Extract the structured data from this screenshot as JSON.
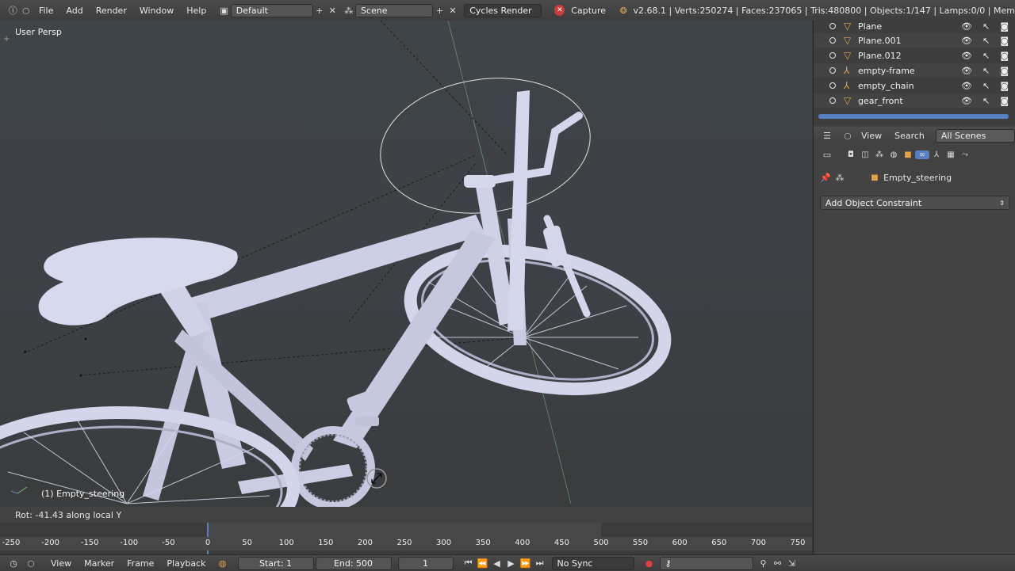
{
  "topbar": {
    "menus": [
      "File",
      "Add",
      "Render",
      "Window",
      "Help"
    ],
    "layout": "Default",
    "scene": "Scene",
    "engine": "Cycles Render",
    "capture": "Capture",
    "stats": "v2.68.1 | Verts:250274 | Faces:237065 | Tris:480800 | Objects:1/147 | Lamps:0/0 | Mem"
  },
  "viewport": {
    "view_name": "User Persp",
    "object_label": "(1) Empty_steering",
    "status": "Rot: -41.43 along local Y"
  },
  "outliner": {
    "rows": [
      {
        "name": "Plane",
        "type": "mesh"
      },
      {
        "name": "Plane.001",
        "type": "mesh"
      },
      {
        "name": "Plane.012",
        "type": "mesh"
      },
      {
        "name": "empty-frame",
        "type": "empty"
      },
      {
        "name": "empty_chain",
        "type": "empty"
      },
      {
        "name": "gear_front",
        "type": "mesh"
      }
    ]
  },
  "properties": {
    "header_items": [
      "View",
      "Search",
      "All Scenes"
    ],
    "object_name": "Empty_steering",
    "add_constraint": "Add Object Constraint"
  },
  "timeline": {
    "ticks": [
      "-250",
      "-200",
      "-150",
      "-100",
      "-50",
      "0",
      "50",
      "100",
      "150",
      "200",
      "250",
      "300",
      "350",
      "400",
      "450",
      "500",
      "550",
      "600",
      "650",
      "700",
      "750"
    ]
  },
  "bottombar": {
    "menus": [
      "View",
      "Marker",
      "Frame",
      "Playback"
    ],
    "start": "Start: 1",
    "end": "End: 500",
    "current": "1",
    "sync": "No Sync"
  },
  "colors": {
    "accent": "#5680c2",
    "empty_orange": "#e7a14a",
    "model": "#c9cbe2"
  }
}
